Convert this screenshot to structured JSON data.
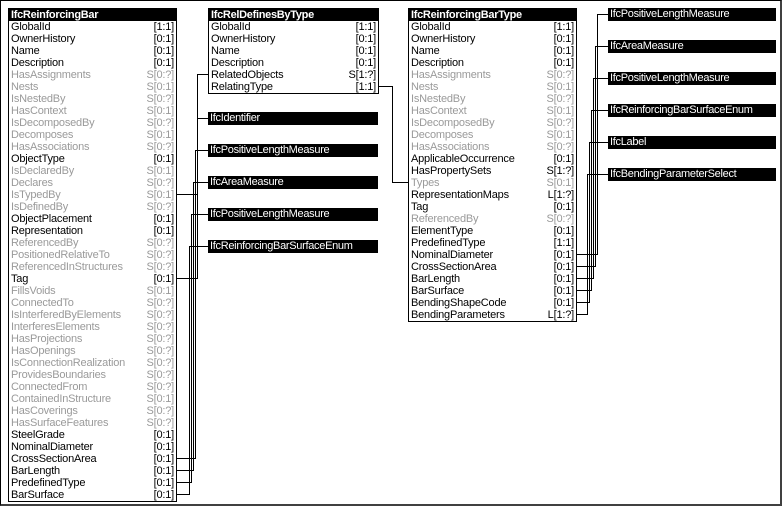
{
  "entities": {
    "reinforcing_bar": {
      "title": "IfcReinforcingBar",
      "attributes": [
        {
          "name": "GlobalId",
          "card": "[1:1]",
          "inverse": false
        },
        {
          "name": "OwnerHistory",
          "card": "[0:1]",
          "inverse": false
        },
        {
          "name": "Name",
          "card": "[0:1]",
          "inverse": false
        },
        {
          "name": "Description",
          "card": "[0:1]",
          "inverse": false
        },
        {
          "name": "HasAssignments",
          "card": "S[0:?]",
          "inverse": true
        },
        {
          "name": "Nests",
          "card": "S[0:1]",
          "inverse": true
        },
        {
          "name": "IsNestedBy",
          "card": "S[0:?]",
          "inverse": true
        },
        {
          "name": "HasContext",
          "card": "S[0:1]",
          "inverse": true
        },
        {
          "name": "IsDecomposedBy",
          "card": "S[0:?]",
          "inverse": true
        },
        {
          "name": "Decomposes",
          "card": "S[0:1]",
          "inverse": true
        },
        {
          "name": "HasAssociations",
          "card": "S[0:?]",
          "inverse": true
        },
        {
          "name": "ObjectType",
          "card": "[0:1]",
          "inverse": false
        },
        {
          "name": "IsDeclaredBy",
          "card": "S[0:1]",
          "inverse": true
        },
        {
          "name": "Declares",
          "card": "S[0:?]",
          "inverse": true
        },
        {
          "name": "IsTypedBy",
          "card": "S[0:1]",
          "inverse": true
        },
        {
          "name": "IsDefinedBy",
          "card": "S[0:?]",
          "inverse": true
        },
        {
          "name": "ObjectPlacement",
          "card": "[0:1]",
          "inverse": false
        },
        {
          "name": "Representation",
          "card": "[0:1]",
          "inverse": false
        },
        {
          "name": "ReferencedBy",
          "card": "S[0:?]",
          "inverse": true
        },
        {
          "name": "PositionedRelativeTo",
          "card": "S[0:?]",
          "inverse": true
        },
        {
          "name": "ReferencedInStructures",
          "card": "S[0:?]",
          "inverse": true
        },
        {
          "name": "Tag",
          "card": "[0:1]",
          "inverse": false
        },
        {
          "name": "FillsVoids",
          "card": "S[0:1]",
          "inverse": true
        },
        {
          "name": "ConnectedTo",
          "card": "S[0:?]",
          "inverse": true
        },
        {
          "name": "IsInterferedByElements",
          "card": "S[0:?]",
          "inverse": true
        },
        {
          "name": "InterferesElements",
          "card": "S[0:?]",
          "inverse": true
        },
        {
          "name": "HasProjections",
          "card": "S[0:?]",
          "inverse": true
        },
        {
          "name": "HasOpenings",
          "card": "S[0:?]",
          "inverse": true
        },
        {
          "name": "IsConnectionRealization",
          "card": "S[0:?]",
          "inverse": true
        },
        {
          "name": "ProvidesBoundaries",
          "card": "S[0:?]",
          "inverse": true
        },
        {
          "name": "ConnectedFrom",
          "card": "S[0:?]",
          "inverse": true
        },
        {
          "name": "ContainedInStructure",
          "card": "S[0:1]",
          "inverse": true
        },
        {
          "name": "HasCoverings",
          "card": "S[0:?]",
          "inverse": true
        },
        {
          "name": "HasSurfaceFeatures",
          "card": "S[0:?]",
          "inverse": true
        },
        {
          "name": "SteelGrade",
          "card": "[0:1]",
          "inverse": false
        },
        {
          "name": "NominalDiameter",
          "card": "[0:1]",
          "inverse": false
        },
        {
          "name": "CrossSectionArea",
          "card": "[0:1]",
          "inverse": false
        },
        {
          "name": "BarLength",
          "card": "[0:1]",
          "inverse": false
        },
        {
          "name": "PredefinedType",
          "card": "[0:1]",
          "inverse": false
        },
        {
          "name": "BarSurface",
          "card": "[0:1]",
          "inverse": false
        }
      ]
    },
    "rel_defines_by_type": {
      "title": "IfcRelDefinesByType",
      "attributes": [
        {
          "name": "GlobalId",
          "card": "[1:1]",
          "inverse": false
        },
        {
          "name": "OwnerHistory",
          "card": "[0:1]",
          "inverse": false
        },
        {
          "name": "Name",
          "card": "[0:1]",
          "inverse": false
        },
        {
          "name": "Description",
          "card": "[0:1]",
          "inverse": false
        },
        {
          "name": "RelatedObjects",
          "card": "S[1:?]",
          "inverse": false
        },
        {
          "name": "RelatingType",
          "card": "[1:1]",
          "inverse": false
        }
      ]
    },
    "reinforcing_bar_type": {
      "title": "IfcReinforcingBarType",
      "attributes": [
        {
          "name": "GlobalId",
          "card": "[1:1]",
          "inverse": false
        },
        {
          "name": "OwnerHistory",
          "card": "[0:1]",
          "inverse": false
        },
        {
          "name": "Name",
          "card": "[0:1]",
          "inverse": false
        },
        {
          "name": "Description",
          "card": "[0:1]",
          "inverse": false
        },
        {
          "name": "HasAssignments",
          "card": "S[0:?]",
          "inverse": true
        },
        {
          "name": "Nests",
          "card": "S[0:1]",
          "inverse": true
        },
        {
          "name": "IsNestedBy",
          "card": "S[0:?]",
          "inverse": true
        },
        {
          "name": "HasContext",
          "card": "S[0:1]",
          "inverse": true
        },
        {
          "name": "IsDecomposedBy",
          "card": "S[0:?]",
          "inverse": true
        },
        {
          "name": "Decomposes",
          "card": "S[0:1]",
          "inverse": true
        },
        {
          "name": "HasAssociations",
          "card": "S[0:?]",
          "inverse": true
        },
        {
          "name": "ApplicableOccurrence",
          "card": "[0:1]",
          "inverse": false
        },
        {
          "name": "HasPropertySets",
          "card": "S[1:?]",
          "inverse": false
        },
        {
          "name": "Types",
          "card": "S[0:1]",
          "inverse": true
        },
        {
          "name": "RepresentationMaps",
          "card": "L[1:?]",
          "inverse": false
        },
        {
          "name": "Tag",
          "card": "[0:1]",
          "inverse": false
        },
        {
          "name": "ReferencedBy",
          "card": "S[0:?]",
          "inverse": true
        },
        {
          "name": "ElementType",
          "card": "[0:1]",
          "inverse": false
        },
        {
          "name": "PredefinedType",
          "card": "[1:1]",
          "inverse": false
        },
        {
          "name": "NominalDiameter",
          "card": "[0:1]",
          "inverse": false
        },
        {
          "name": "CrossSectionArea",
          "card": "[0:1]",
          "inverse": false
        },
        {
          "name": "BarLength",
          "card": "[0:1]",
          "inverse": false
        },
        {
          "name": "BarSurface",
          "card": "[0:1]",
          "inverse": false
        },
        {
          "name": "BendingShapeCode",
          "card": "[0:1]",
          "inverse": false
        },
        {
          "name": "BendingParameters",
          "card": "L[1:?]",
          "inverse": false
        }
      ]
    }
  },
  "type_labels_middle": [
    "IfcIdentifier",
    "IfcPositiveLengthMeasure",
    "IfcAreaMeasure",
    "IfcPositiveLengthMeasure",
    "IfcReinforcingBarSurfaceEnum"
  ],
  "type_labels_right": [
    "IfcPositiveLengthMeasure",
    "IfcAreaMeasure",
    "IfcPositiveLengthMeasure",
    "IfcReinforcingBarSurfaceEnum",
    "IfcLabel",
    "IfcBendingParameterSelect"
  ],
  "colors": {
    "header_bg": "#000000",
    "header_text": "#ffffff",
    "attribute_text": "#000000",
    "inverse_attribute_text": "#9a9a9a"
  }
}
